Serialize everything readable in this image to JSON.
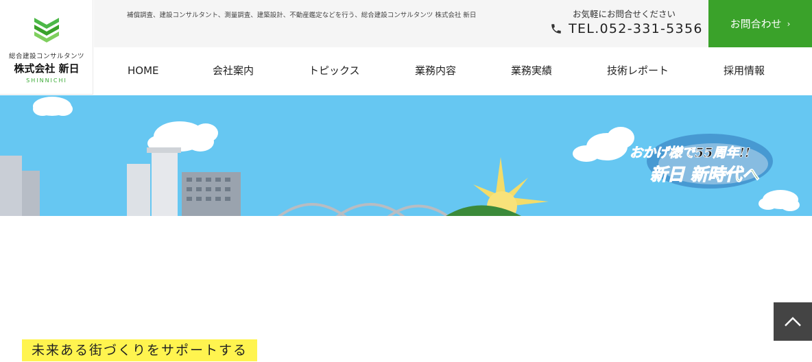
{
  "logo": {
    "icon": "chevron-stack-logo",
    "subtitle": "総合建設コンサルタンツ",
    "name": "株式会社 新日",
    "roman": "SHINNICHI"
  },
  "header": {
    "tagline": "補償調査、建設コンサルタント、測量調査、建築設計、不動産鑑定などを行う、総合建設コンサルタンツ 株式会社 新日",
    "contact_caption": "お気軽にお問合せください",
    "phone": "TEL.052-331-5356",
    "contact_button": "お問合わせ"
  },
  "nav": {
    "items": [
      {
        "label": "HOME"
      },
      {
        "label": "会社案内"
      },
      {
        "label": "トピックス"
      },
      {
        "label": "業務内容"
      },
      {
        "label": "業務実績"
      },
      {
        "label": "技術レポート"
      },
      {
        "label": "採用情報"
      }
    ]
  },
  "hero": {
    "line1": "おかげ様で55周年!!",
    "line2": "新日 新時代へ"
  },
  "main": {
    "slogan": "未来ある街づくりをサポートする"
  },
  "colors": {
    "brand_green": "#3aa22a",
    "sky": "#66c7f2",
    "highlight": "#fff44f"
  }
}
